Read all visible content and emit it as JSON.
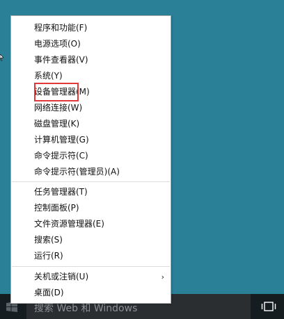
{
  "context_menu": {
    "items": [
      {
        "label": "程序和功能(F)"
      },
      {
        "label": "电源选项(O)"
      },
      {
        "label": "事件查看器(V)"
      },
      {
        "label": "系统(Y)"
      },
      {
        "label": "设备管理器(M)"
      },
      {
        "label": "网络连接(W)"
      },
      {
        "label": "磁盘管理(K)"
      },
      {
        "label": "计算机管理(G)"
      },
      {
        "label": "命令提示符(C)"
      },
      {
        "label": "命令提示符(管理员)(A)"
      },
      {
        "label": "任务管理器(T)"
      },
      {
        "label": "控制面板(P)"
      },
      {
        "label": "文件资源管理器(E)"
      },
      {
        "label": "搜索(S)"
      },
      {
        "label": "运行(R)"
      },
      {
        "label": "关机或注销(U)",
        "submenu_arrow": "›"
      },
      {
        "label": "桌面(D)"
      }
    ],
    "highlighted_item": "系统(Y)",
    "highlight_color": "#e0383b"
  },
  "taskbar": {
    "search_placeholder": "搜索 Web 和 Windows",
    "icons": [
      "windows-logo-icon",
      "task-view-icon"
    ],
    "background_color": "#161d21"
  },
  "desktop": {
    "background_color": "#2a8197"
  }
}
